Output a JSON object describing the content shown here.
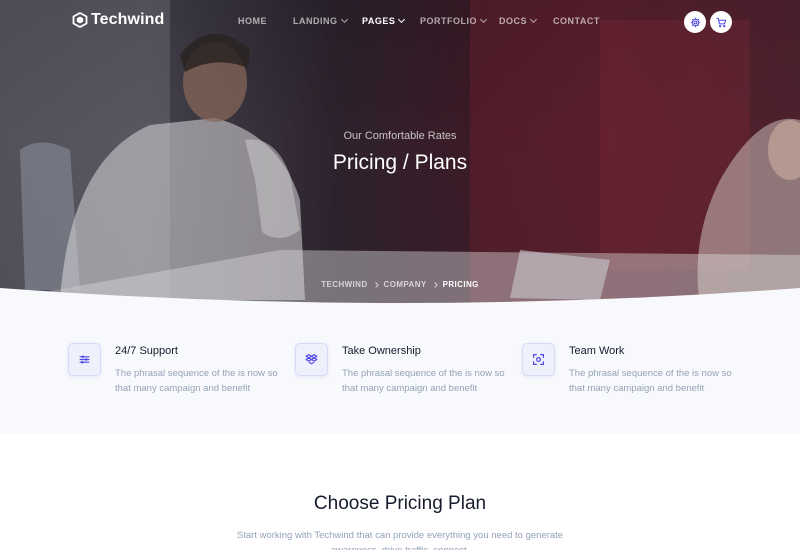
{
  "brand": {
    "name": "Techwind"
  },
  "nav": {
    "items": [
      {
        "label": "HOME",
        "dropdown": false,
        "active": false
      },
      {
        "label": "LANDING",
        "dropdown": true,
        "active": false
      },
      {
        "label": "PAGES",
        "dropdown": true,
        "active": true
      },
      {
        "label": "PORTFOLIO",
        "dropdown": true,
        "active": false
      },
      {
        "label": "DOCS",
        "dropdown": true,
        "active": false
      },
      {
        "label": "CONTACT",
        "dropdown": false,
        "active": false
      }
    ],
    "buttons": [
      {
        "icon": "gear-icon"
      },
      {
        "icon": "cart-icon"
      }
    ]
  },
  "hero": {
    "subtitle": "Our Comfortable Rates",
    "title": "Pricing / Plans",
    "breadcrumb": [
      "TECHWIND",
      "COMPANY",
      "PRICING"
    ]
  },
  "features": [
    {
      "title": "24/7 Support",
      "description": "The phrasal sequence of the is now so that many campaign and benefit",
      "icon": "equalizer-icon"
    },
    {
      "title": "Take Ownership",
      "description": "The phrasal sequence of the is now so that many campaign and benefit",
      "icon": "dropbox-icon"
    },
    {
      "title": "Team Work",
      "description": "The phrasal sequence of the is now so that many campaign and benefit",
      "icon": "focus-icon"
    }
  ],
  "pricing": {
    "title": "Choose Pricing Plan",
    "description": "Start working with Techwind that can provide everything you need to generate awareness, drive traffic, connect."
  },
  "colors": {
    "accent": "#4f46e5",
    "heading": "#161c2d",
    "muted": "#94a3b8",
    "section_bg": "#f8f9fc"
  }
}
